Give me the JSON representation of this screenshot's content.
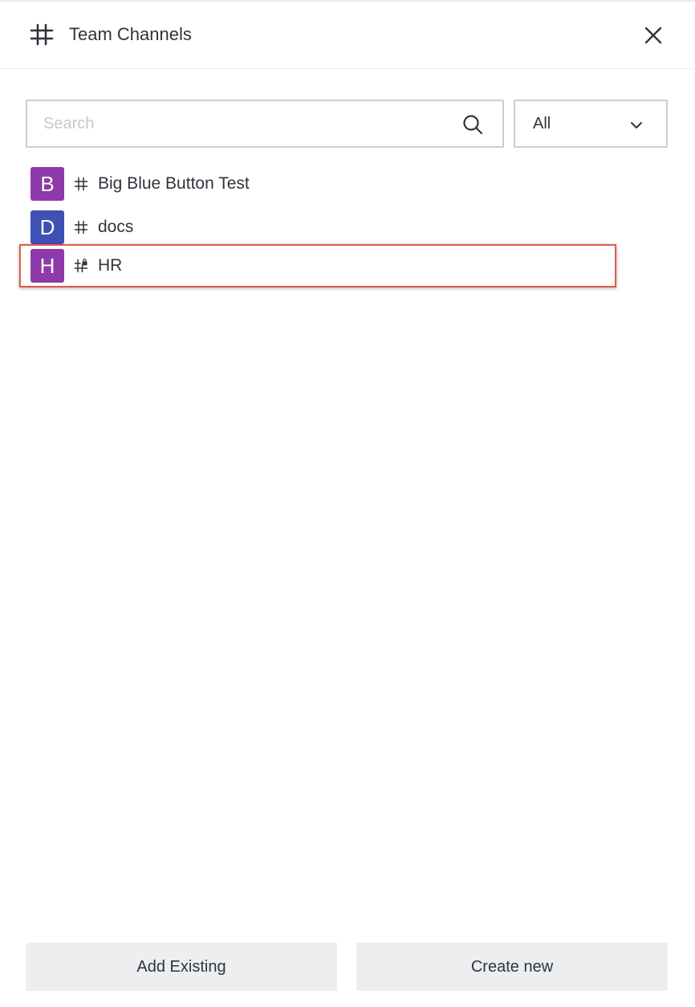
{
  "header": {
    "title": "Team Channels",
    "icon": "hash-icon",
    "close_icon": "close-icon"
  },
  "search": {
    "placeholder": "Search",
    "value": ""
  },
  "filter": {
    "selected": "All"
  },
  "channels": [
    {
      "initial": "B",
      "name": "Big Blue Button Test",
      "avatar_color": "#8e3aa8",
      "private": false,
      "selected": false
    },
    {
      "initial": "D",
      "name": "docs",
      "avatar_color": "#3f51b5",
      "private": false,
      "selected": false
    },
    {
      "initial": "H",
      "name": "HR",
      "avatar_color": "#8e3aa8",
      "private": true,
      "selected": true
    }
  ],
  "footer": {
    "add_existing_label": "Add Existing",
    "create_new_label": "Create new"
  },
  "colors": {
    "selection_border": "#e05a4c",
    "button_bg": "#eceef0"
  }
}
